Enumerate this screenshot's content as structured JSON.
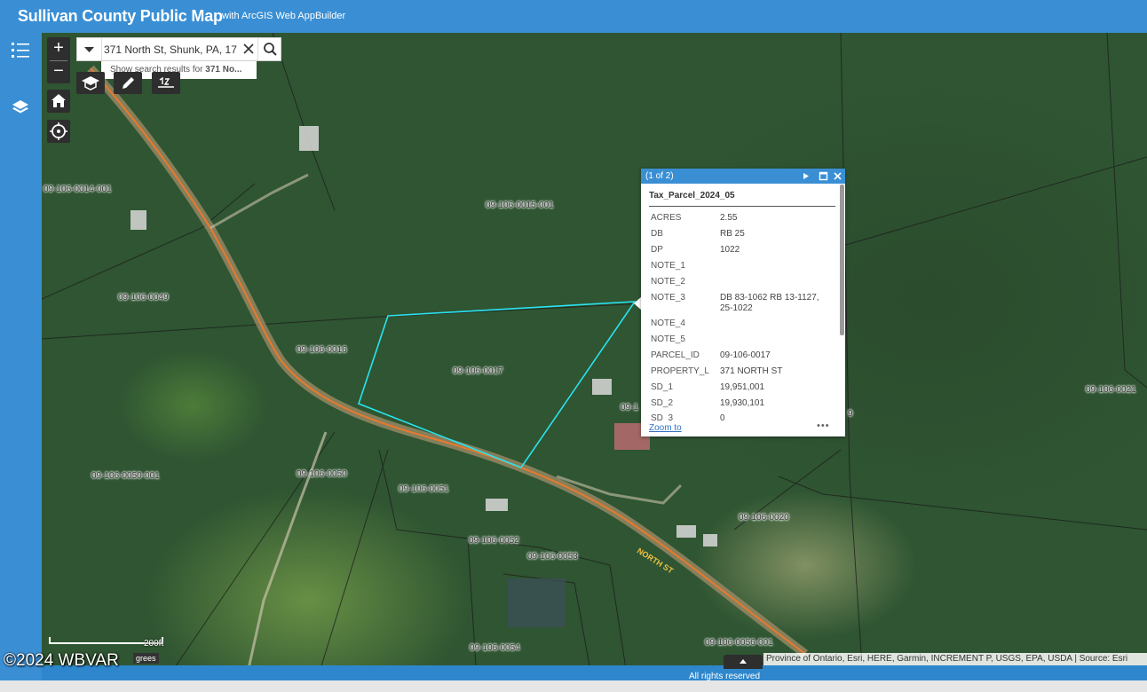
{
  "header": {
    "title": "Sullivan County Public Map",
    "subtitle": "with ArcGIS Web AppBuilder"
  },
  "leftbar": {
    "items": [
      {
        "icon": "list-icon"
      },
      {
        "icon": "layers-icon"
      }
    ]
  },
  "map_controls": {
    "zoom_in": "+",
    "zoom_out": "−",
    "home_icon": "home-icon",
    "locate_icon": "locate-icon"
  },
  "search": {
    "value": "371 North St, Shunk, PA, 17",
    "suggestion_prefix": "Show search results for ",
    "suggestion_bold": "371 No..."
  },
  "tools": [
    {
      "icon": "graduation-cap-icon"
    },
    {
      "icon": "pencil-icon"
    },
    {
      "icon": "measure-icon"
    }
  ],
  "parcel_labels": [
    "09-106-0014-001",
    "09-106-0015-001",
    "09-106-0049",
    "09-106-0016",
    "09-106-0017",
    "09-106-0021",
    "09-106-0050-001",
    "09-106-0050",
    "09-106-0051",
    "09-106-0052",
    "09-106-0053",
    "09-106-0020",
    "09-106-0054",
    "09-106-0056-001",
    "09-1",
    "9"
  ],
  "street_label": "NORTH ST",
  "popup": {
    "count": "(1 of 2)",
    "title": "Tax_Parcel_2024_05",
    "fields": [
      {
        "key": "ACRES",
        "value": "2.55"
      },
      {
        "key": "DB",
        "value": "RB 25"
      },
      {
        "key": "DP",
        "value": "1022"
      },
      {
        "key": "NOTE_1",
        "value": ""
      },
      {
        "key": "NOTE_2",
        "value": ""
      },
      {
        "key": "NOTE_3",
        "value": "DB 83-1062 RB 13-1127, 25-1022"
      },
      {
        "key": "NOTE_4",
        "value": ""
      },
      {
        "key": "NOTE_5",
        "value": ""
      },
      {
        "key": "PARCEL_ID",
        "value": "09-106-0017"
      },
      {
        "key": "PROPERTY_L",
        "value": "371 NORTH ST"
      },
      {
        "key": "SD_1",
        "value": "19,951,001"
      },
      {
        "key": "SD_2",
        "value": "19,930,101"
      },
      {
        "key": "SD_3",
        "value": "0"
      }
    ],
    "zoom_to": "Zoom to",
    "more": "•••"
  },
  "scale": {
    "label": "200ft"
  },
  "coordinates_text": "grees",
  "watermark": "©2024 WBVAR",
  "attribution": "Province of Ontario, Esri, HERE, Garmin, INCREMENT P, USGS, EPA, USDA | Source: Esri",
  "rights": "All rights reserved",
  "colors": {
    "header": "#3a8fd4",
    "selected_parcel": "#29e3f0",
    "road": "#e87a2c"
  }
}
